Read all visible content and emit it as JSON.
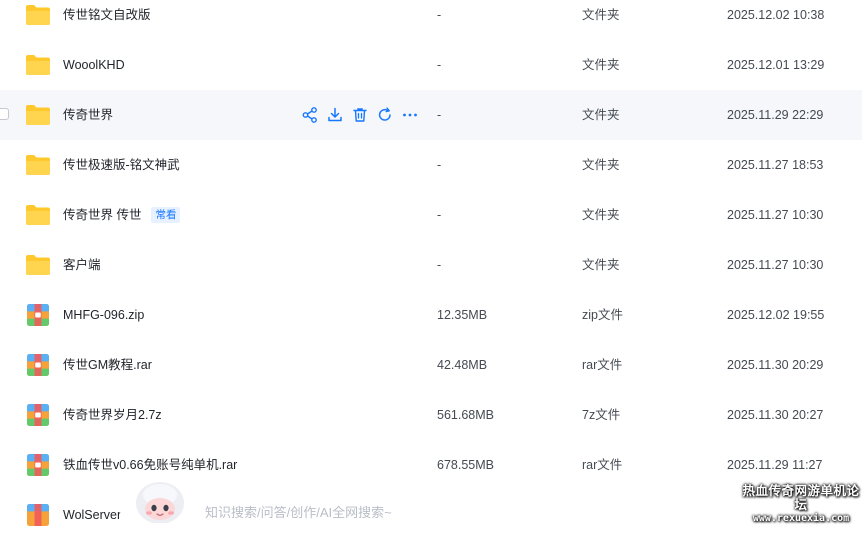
{
  "files": [
    {
      "name": "传世铭文自改版",
      "size": "-",
      "type": "文件夹",
      "time": "2025.12.02 10:38",
      "icon": "folder-icon"
    },
    {
      "name": "WooolKHD",
      "size": "-",
      "type": "文件夹",
      "time": "2025.12.01 13:29",
      "icon": "folder-icon"
    },
    {
      "name": "传奇世界",
      "size": "-",
      "type": "文件夹",
      "time": "2025.11.29 22:29",
      "icon": "folder-icon"
    },
    {
      "name": "传世极速版-铭文神武",
      "size": "-",
      "type": "文件夹",
      "time": "2025.11.27 18:53",
      "icon": "folder-icon"
    },
    {
      "name": "传奇世界 传世",
      "size": "-",
      "type": "文件夹",
      "time": "2025.11.27 10:30",
      "icon": "folder-icon",
      "badge": "常看"
    },
    {
      "name": "客户端",
      "size": "-",
      "type": "文件夹",
      "time": "2025.11.27 10:30",
      "icon": "folder-icon"
    },
    {
      "name": "MHFG-096.zip",
      "size": "12.35MB",
      "type": "zip文件",
      "time": "2025.12.02 19:55",
      "icon": "archive-icon"
    },
    {
      "name": "传世GM教程.rar",
      "size": "42.48MB",
      "type": "rar文件",
      "time": "2025.11.30 20:29",
      "icon": "archive-icon"
    },
    {
      "name": "传奇世界岁月2.7z",
      "size": "561.68MB",
      "type": "7z文件",
      "time": "2025.11.30 20:27",
      "icon": "archive-icon"
    },
    {
      "name": "铁血传世v0.66免账号纯单机.rar",
      "size": "678.55MB",
      "type": "rar文件",
      "time": "2025.11.29 11:27",
      "icon": "archive-icon"
    },
    {
      "name": "WolServer",
      "size": "",
      "type": "",
      "time": "",
      "icon": "archive-icon"
    }
  ],
  "hovered_row_actions": [
    "share-icon",
    "download-icon",
    "delete-icon",
    "refresh-icon",
    "more-icon"
  ],
  "assistant": {
    "placeholder": "知识搜索/问答/创作/AI全网搜索~"
  },
  "watermark": {
    "title": "热血传奇网游单机论坛",
    "url": "www.rexuexia.com"
  },
  "colors": {
    "folder": "#ffc82c",
    "accent": "#1677ff",
    "hover_row": "#f5f7fb"
  }
}
